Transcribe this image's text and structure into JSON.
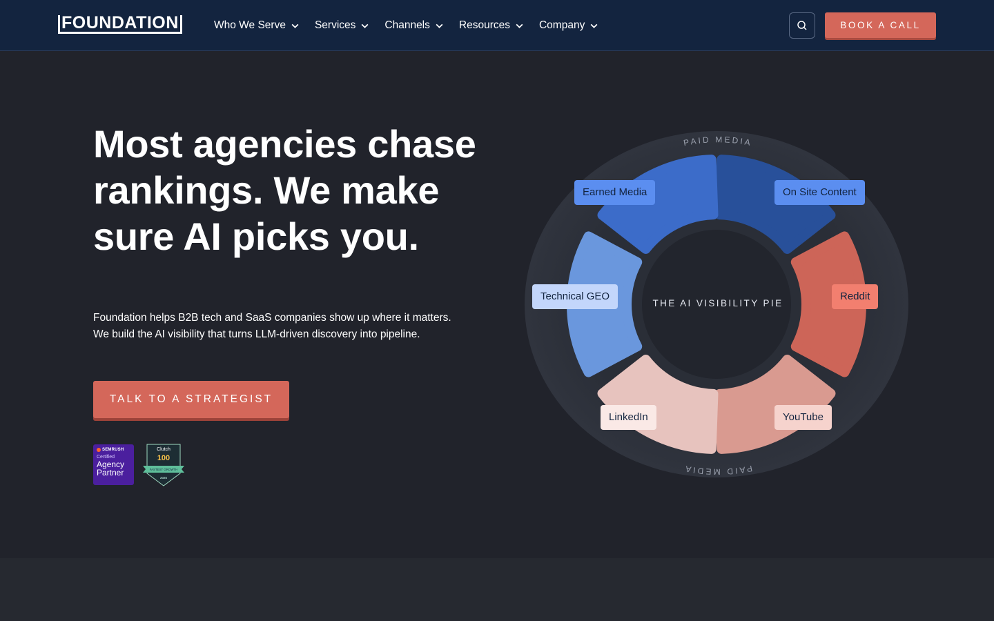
{
  "nav": {
    "logo_text": "FOUNDATION",
    "menu": [
      {
        "label": "Who We Serve",
        "icon": "chevron-down-icon"
      },
      {
        "label": "Services",
        "icon": "chevron-down-icon"
      },
      {
        "label": "Channels",
        "icon": "chevron-down-icon"
      },
      {
        "label": "Resources",
        "icon": "chevron-down-icon"
      },
      {
        "label": "Company",
        "icon": "chevron-down-icon"
      }
    ],
    "search_icon": "search-icon",
    "book_label": "BOOK A CALL"
  },
  "hero": {
    "title": "Most agencies chase rankings. We make sure AI picks you.",
    "subtitle_line1": "Foundation helps B2B tech and SaaS companies show up where it matters.",
    "subtitle_line2": "We build the AI visibility that turns LLM-driven discovery into pipeline.",
    "cta_label": "TALK TO A STRATEGIST"
  },
  "badges": {
    "semrush": {
      "brand": "SEMRUSH",
      "line1": "Certified",
      "line2": "Agency",
      "line3": "Partner"
    },
    "clutch": {
      "brand": "Clutch",
      "number": "100",
      "ribbon": "FASTEST GROWTH",
      "year": "2025"
    }
  },
  "pie": {
    "center_label": "THE AI VISIBILITY PIE",
    "ring_label_top": "PAID MEDIA",
    "ring_label_bottom": "PAID MEDIA",
    "segments": {
      "earned": "Earned Media",
      "onsite": "On Site Content",
      "technical": "Technical GEO",
      "reddit": "Reddit",
      "linkedin": "LinkedIn",
      "youtube": "YouTube"
    },
    "colors": {
      "earned": "#3c6cc9",
      "onsite": "#28509a",
      "technical": "#6a97dd",
      "reddit": "#cd6558",
      "linkedin": "#e7c3be",
      "youtube": "#d99a90",
      "ring": "#2b2f38"
    }
  },
  "colors": {
    "nav_bg": "#13243f",
    "page_bg": "#21232b",
    "accent": "#d4675a"
  }
}
